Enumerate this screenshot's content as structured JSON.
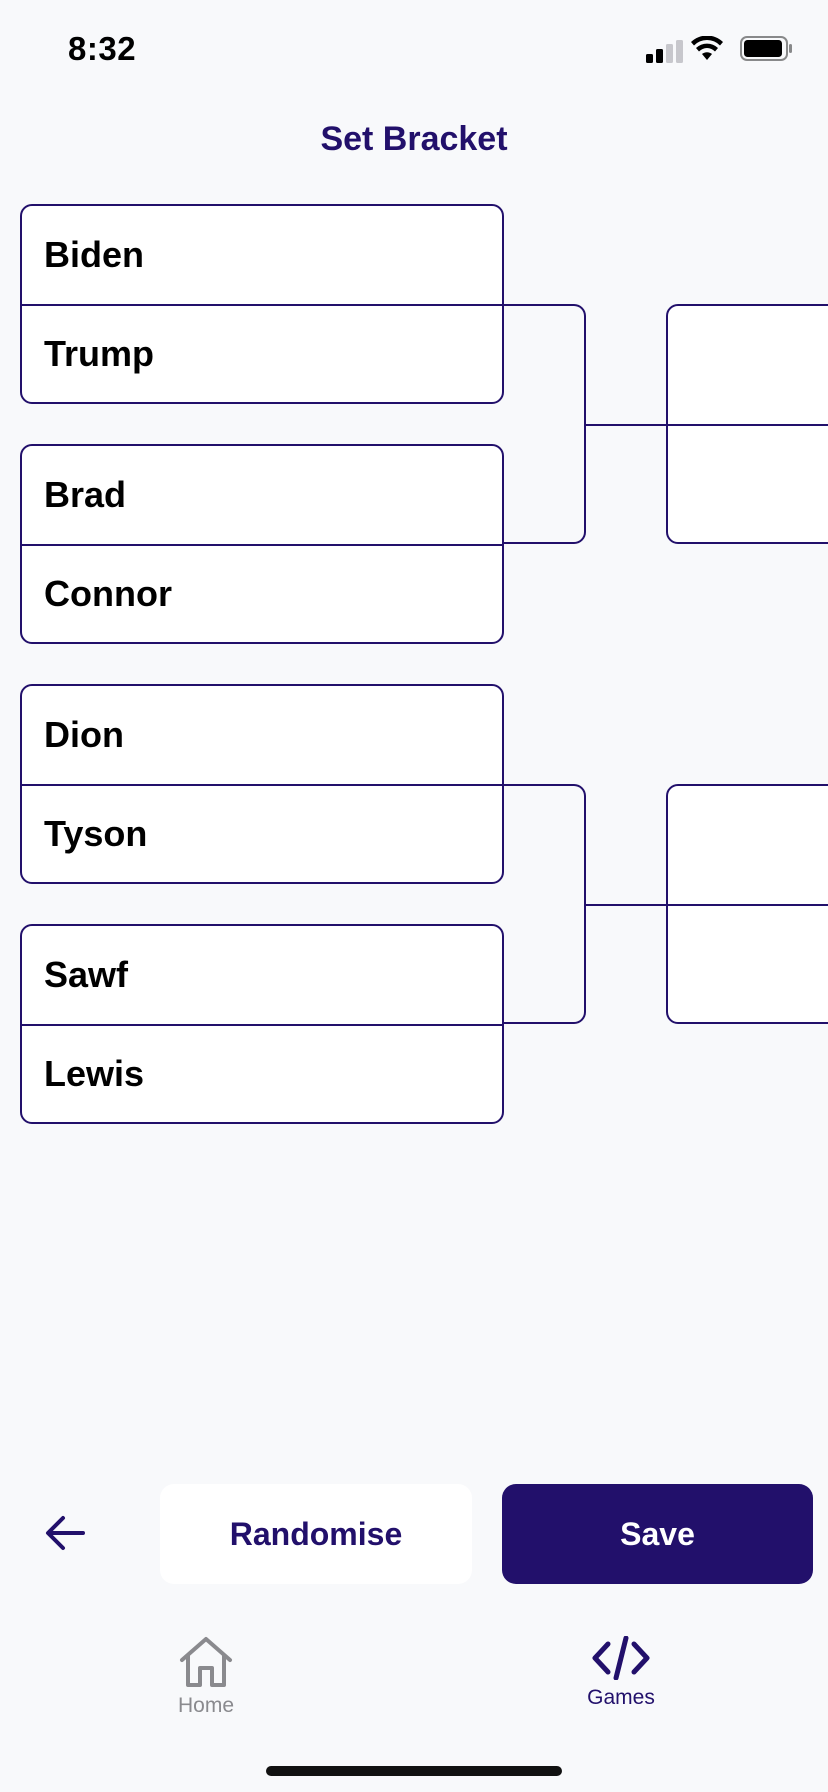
{
  "status_bar": {
    "time": "8:32",
    "signal_icon": "cellular-signal-icon",
    "wifi_icon": "wifi-icon",
    "battery_icon": "battery-icon"
  },
  "header": {
    "title": "Set Bracket"
  },
  "bracket": {
    "round1": [
      {
        "top": "Biden",
        "bottom": "Trump"
      },
      {
        "top": "Brad",
        "bottom": "Connor"
      },
      {
        "top": "Dion",
        "bottom": "Tyson"
      },
      {
        "top": "Sawf",
        "bottom": "Lewis"
      }
    ],
    "round2": [
      {
        "top": "",
        "bottom": ""
      },
      {
        "top": "",
        "bottom": ""
      }
    ]
  },
  "actions": {
    "back_icon": "arrow-left-icon",
    "randomise_label": "Randomise",
    "save_label": "Save"
  },
  "tab_bar": {
    "tabs": [
      {
        "label": "Home",
        "icon": "house-icon",
        "active": false
      },
      {
        "label": "Games",
        "icon": "code-icon",
        "active": true
      }
    ]
  },
  "colors": {
    "primary": "#22106b",
    "background": "#f8f9fb",
    "inactive_tab": "#8a8a8e"
  }
}
